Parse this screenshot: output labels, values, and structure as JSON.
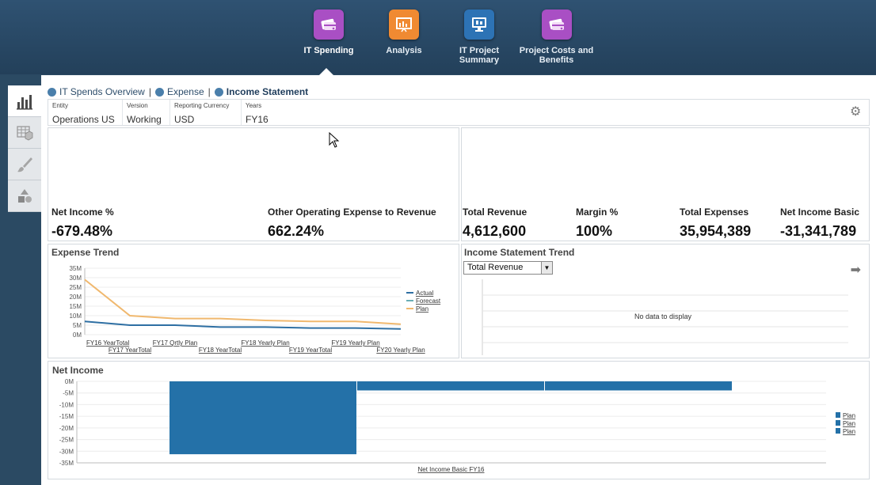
{
  "nav": {
    "items": [
      {
        "label": "IT Spending",
        "icon": "card-icon",
        "color": "#a94fc4",
        "active": true
      },
      {
        "label": "Analysis",
        "icon": "presentation-chart-icon",
        "color": "#f08a32",
        "active": false
      },
      {
        "label": "IT Project Summary",
        "icon": "monitor-icon",
        "color": "#2d73b5",
        "active": false
      },
      {
        "label": "Project Costs and Benefits",
        "icon": "card-icon",
        "color": "#a94fc4",
        "active": false
      }
    ]
  },
  "sidebar": {
    "items": [
      {
        "icon": "bar-chart-icon",
        "active": true
      },
      {
        "icon": "grid-cube-icon",
        "active": false
      },
      {
        "icon": "brush-icon",
        "active": false
      },
      {
        "icon": "shapes-icon",
        "active": false
      }
    ]
  },
  "breadcrumb": {
    "items": [
      "IT Spends Overview",
      "Expense",
      "Income Statement"
    ]
  },
  "pov": {
    "columns": [
      {
        "label": "Entity",
        "value": "Operations US"
      },
      {
        "label": "Version",
        "value": "Working"
      },
      {
        "label": "Reporting Currency",
        "value": "USD"
      },
      {
        "label": "Years",
        "value": "FY16"
      }
    ]
  },
  "kpis": {
    "net_income_pct": {
      "title": "Net Income %",
      "value": "-679.48%"
    },
    "other_opex": {
      "title": "Other Operating Expense to Revenue",
      "value": "662.24%"
    },
    "total_revenue": {
      "title": "Total Revenue",
      "value": "4,612,600"
    },
    "margin_pct": {
      "title": "Margin %",
      "value": "100%"
    },
    "total_expenses": {
      "title": "Total Expenses",
      "value": "35,954,389"
    },
    "net_income_basic": {
      "title": "Net Income Basic",
      "value": "-31,341,789"
    }
  },
  "income_trend": {
    "title": "Income Statement Trend",
    "selected": "Total Revenue",
    "no_data": "No data to display"
  },
  "colors": {
    "actual": "#2e6fa3",
    "forecast": "#6aaeb5",
    "plan": "#f0b86e",
    "net_bar": "#2471a8"
  },
  "chart_data": [
    {
      "type": "line",
      "title": "Expense Trend",
      "categories": [
        "FY16 YearTotal",
        "FY17 YearTotal",
        "FY17 Qrtly Plan",
        "FY18 YearTotal",
        "FY18 Yearly Plan",
        "FY19 YearTotal",
        "FY19 Yearly Plan",
        "FY20 Yearly Plan"
      ],
      "ytick_labels": [
        "35M",
        "30M",
        "25M",
        "20M",
        "15M",
        "10M",
        "5M",
        "0M"
      ],
      "ylim": [
        0,
        35
      ],
      "series": [
        {
          "name": "Actual",
          "values": [
            7,
            5,
            5,
            4,
            4,
            3.5,
            3.5,
            3
          ]
        },
        {
          "name": "Forecast",
          "values": [
            null,
            null,
            null,
            null,
            null,
            null,
            null,
            null
          ]
        },
        {
          "name": "Plan",
          "values": [
            29,
            10,
            8.5,
            8.5,
            7.5,
            7,
            7,
            5.5
          ]
        }
      ],
      "legend": "right",
      "grid": true
    },
    {
      "type": "bar",
      "title": "Net Income",
      "categories": [
        "Net Income Basic FY16"
      ],
      "ytick_labels": [
        "0M",
        "-5M",
        "-10M",
        "-15M",
        "-20M",
        "-25M",
        "-30M",
        "-35M"
      ],
      "ylim": [
        -35,
        0
      ],
      "series": [
        {
          "name": "Plan",
          "values": [
            -31.3
          ]
        },
        {
          "name": "Plan",
          "values": [
            -3.9
          ]
        },
        {
          "name": "Plan",
          "values": [
            -3.9
          ]
        }
      ],
      "legend": "right",
      "grid": true
    }
  ]
}
